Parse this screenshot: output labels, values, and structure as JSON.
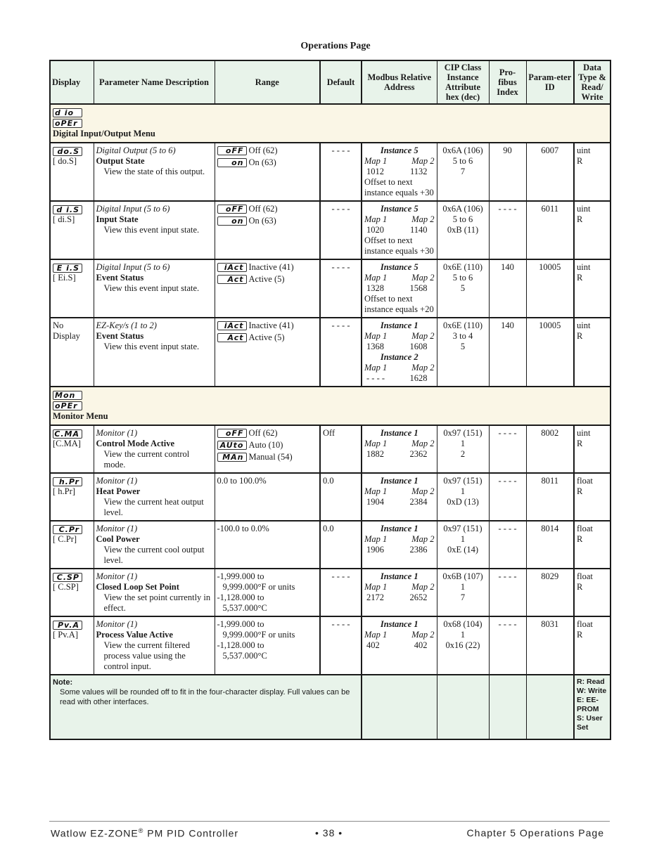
{
  "page_title": "Operations Page",
  "headers": {
    "display": "Display",
    "param_name": "Parameter Name Description",
    "range": "Range",
    "default": "Default",
    "modbus": "Modbus Relative Address",
    "cip": "CIP Class Instance Attribute hex (dec)",
    "profibus": "Pro-fibus Index",
    "param_id": "Param-eter ID",
    "data_type": "Data Type & Read/ Write"
  },
  "menus": [
    {
      "codes": [
        "d io",
        "oPEr"
      ],
      "label": "Digital Input/Output Menu",
      "rows": [
        {
          "display_code": "do.S",
          "display_text": "[ do.S]",
          "group": "Digital Output (5 to 6)",
          "name": "Output State",
          "desc": "View the state of this output.",
          "range": [
            {
              "code": "oFF",
              "text": "Off (62)"
            },
            {
              "code": "on",
              "text": "On (63)"
            }
          ],
          "default": "- - - -",
          "modbus": {
            "blocks": [
              {
                "instance": "Instance 5",
                "map1": "1012",
                "map2": "1132"
              }
            ],
            "offset": "Offset to next instance equals +30"
          },
          "cip": [
            "0x6A (106)",
            "5 to 6",
            "7"
          ],
          "profibus": "90",
          "param_id": "6007",
          "data_type": [
            "uint",
            "R"
          ]
        },
        {
          "display_code": "d i.S",
          "display_text": "[ di.S]",
          "group": "Digital Input (5 to 6)",
          "name": "Input State",
          "desc": "View this event input state.",
          "range": [
            {
              "code": "oFF",
              "text": "Off (62)"
            },
            {
              "code": "on",
              "text": "On (63)"
            }
          ],
          "default": "- - - -",
          "modbus": {
            "blocks": [
              {
                "instance": "Instance 5",
                "map1": "1020",
                "map2": "1140"
              }
            ],
            "offset": "Offset to next instance equals +30"
          },
          "cip": [
            "0x6A (106)",
            "5 to 6",
            "0xB (11)"
          ],
          "profibus": "- - - -",
          "param_id": "6011",
          "data_type": [
            "uint",
            "R"
          ]
        },
        {
          "display_code": "E i.S",
          "display_text": "[ Ei.S]",
          "group": "Digital Input (5 to 6)",
          "name": "Event Status",
          "desc": "View this event input state.",
          "range": [
            {
              "code": "iAct",
              "text": "Inactive (41)"
            },
            {
              "code": "Act",
              "text": "Active (5)"
            }
          ],
          "default": "- - - -",
          "modbus": {
            "blocks": [
              {
                "instance": "Instance 5",
                "map1": "1328",
                "map2": "1568"
              }
            ],
            "offset": "Offset to next instance equals +20"
          },
          "cip": [
            "0x6E (110)",
            "5 to 6",
            "5"
          ],
          "profibus": "140",
          "param_id": "10005",
          "data_type": [
            "uint",
            "R"
          ]
        },
        {
          "display_code": "",
          "display_text": "No Display",
          "group": "EZ-Key/s (1 to 2)",
          "name": "Event Status",
          "desc": "View this event input state.",
          "range": [
            {
              "code": "iAct",
              "text": "Inactive (41)"
            },
            {
              "code": "Act",
              "text": "Active (5)"
            }
          ],
          "default": "- - - -",
          "modbus": {
            "blocks": [
              {
                "instance": "Instance 1",
                "map1": "1368",
                "map2": "1608"
              },
              {
                "instance": "Instance 2",
                "map1": "- - - -",
                "map2": "1628"
              }
            ],
            "offset": ""
          },
          "cip": [
            "0x6E (110)",
            "3 to 4",
            "5"
          ],
          "profibus": "140",
          "param_id": "10005",
          "data_type": [
            "uint",
            "R"
          ]
        }
      ]
    },
    {
      "codes": [
        "Mon",
        "oPEr"
      ],
      "label": "Monitor Menu",
      "rows": [
        {
          "display_code": "C.MA",
          "display_text": "[C.MA]",
          "group": "Monitor (1)",
          "name": "Control Mode Active",
          "desc": "View the current control mode.",
          "range": [
            {
              "code": "oFF",
              "text": "Off (62)"
            },
            {
              "code": "AUto",
              "text": "Auto (10)"
            },
            {
              "code": "MAn",
              "text": "Manual (54)"
            }
          ],
          "default": "Off",
          "modbus": {
            "blocks": [
              {
                "instance": "Instance 1",
                "map1": "1882",
                "map2": "2362"
              }
            ],
            "offset": ""
          },
          "cip": [
            "0x97 (151)",
            "1",
            "2"
          ],
          "profibus": "- - - -",
          "param_id": "8002",
          "data_type": [
            "uint",
            "R"
          ]
        },
        {
          "display_code": "h.Pr",
          "display_text": "[ h.Pr]",
          "group": "Monitor (1)",
          "name": "Heat Power",
          "desc": "View the current heat output level.",
          "range_text": [
            "0.0 to 100.0%"
          ],
          "default": "0.0",
          "modbus": {
            "blocks": [
              {
                "instance": "Instance 1",
                "map1": "1904",
                "map2": "2384"
              }
            ],
            "offset": ""
          },
          "cip": [
            "0x97 (151)",
            "1",
            "0xD (13)"
          ],
          "profibus": "- - - -",
          "param_id": "8011",
          "data_type": [
            "float",
            "R"
          ]
        },
        {
          "display_code": "C.Pr",
          "display_text": "[ C.Pr]",
          "group": "Monitor (1)",
          "name": "Cool Power",
          "desc": "View the current cool output level.",
          "range_text": [
            "-100.0 to 0.0%"
          ],
          "default": "0.0",
          "modbus": {
            "blocks": [
              {
                "instance": "Instance 1",
                "map1": "1906",
                "map2": "2386"
              }
            ],
            "offset": ""
          },
          "cip": [
            "0x97 (151)",
            "1",
            "0xE (14)"
          ],
          "profibus": "- - - -",
          "param_id": "8014",
          "data_type": [
            "float",
            "R"
          ]
        },
        {
          "display_code": "C.SP",
          "display_text": "[ C.SP]",
          "group": "Monitor (1)",
          "name": "Closed Loop Set Point",
          "desc": "View the set point currently in effect.",
          "range_text": [
            "-1,999.000 to",
            "9,999.000°F or units",
            "-1,128.000 to",
            "5,537.000°C"
          ],
          "default": "- - - -",
          "modbus": {
            "blocks": [
              {
                "instance": "Instance 1",
                "map1": "2172",
                "map2": "2652"
              }
            ],
            "offset": ""
          },
          "cip": [
            "0x6B (107)",
            "1",
            "7"
          ],
          "profibus": "- - - -",
          "param_id": "8029",
          "data_type": [
            "float",
            "R"
          ]
        },
        {
          "display_code": "Pv.A",
          "display_text": "[ Pv.A]",
          "group": "Monitor (1)",
          "name": "Process Value Active",
          "desc": "View the current filtered process value using the control input.",
          "range_text": [
            "-1,999.000 to",
            "9,999.000°F or units",
            "-1,128.000 to",
            "5,537.000°C"
          ],
          "default": "- - - -",
          "modbus": {
            "blocks": [
              {
                "instance": "Instance 1",
                "map1": "402",
                "map2": "402"
              }
            ],
            "offset": ""
          },
          "cip": [
            "0x68 (104)",
            "1",
            "0x16 (22)"
          ],
          "profibus": "- - - -",
          "param_id": "8031",
          "data_type": [
            "float",
            "R"
          ]
        }
      ]
    }
  ],
  "note": {
    "title": "Note:",
    "text": "Some values will be rounded off to fit in the four-character display. Full values can be read with other interfaces.",
    "legend": [
      "R: Read",
      "W: Write",
      "E: EE-PROM",
      "S: User Set"
    ]
  },
  "footer": {
    "left": "Watlow EZ-ZONE",
    "left_reg": "®",
    "left_tail": " PM PID Controller",
    "center": "•  38  •",
    "right": "Chapter 5 Operations Page"
  }
}
